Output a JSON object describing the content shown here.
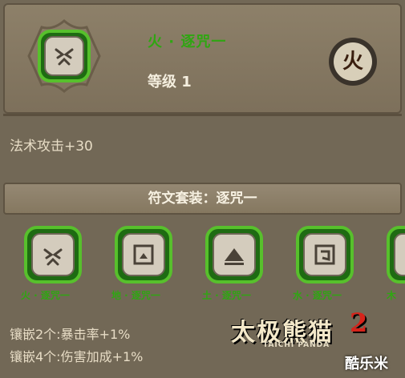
{
  "rune": {
    "name": "火 · 逐咒一",
    "level": "等级 1",
    "element_badge": "火",
    "icon": "fire-rune-icon"
  },
  "stats": [
    "法术攻击+30"
  ],
  "set": {
    "title": "符文套装：逐咒一",
    "slots": [
      {
        "label": "火 · 逐咒一",
        "icon": "fire-rune-icon"
      },
      {
        "label": "地 · 逐咒一",
        "icon": "earth-rune-icon"
      },
      {
        "label": "土 · 逐咒一",
        "icon": "soil-rune-icon"
      },
      {
        "label": "水 · 逐咒一",
        "icon": "water-rune-icon"
      },
      {
        "label": "木",
        "icon": "wood-rune-icon"
      }
    ],
    "bonuses": [
      "镶嵌2个:暴击率+1%",
      "镶嵌4个:伤害加成+1%"
    ]
  },
  "branding": {
    "logo_text": "太极熊猫",
    "logo_number": "2",
    "logo_sub": "TAICHI PANDA",
    "watermark": "酷乐米"
  },
  "colors": {
    "green": "#2fa612",
    "panel": "#8d8069",
    "stone": "#cfc7b7"
  }
}
